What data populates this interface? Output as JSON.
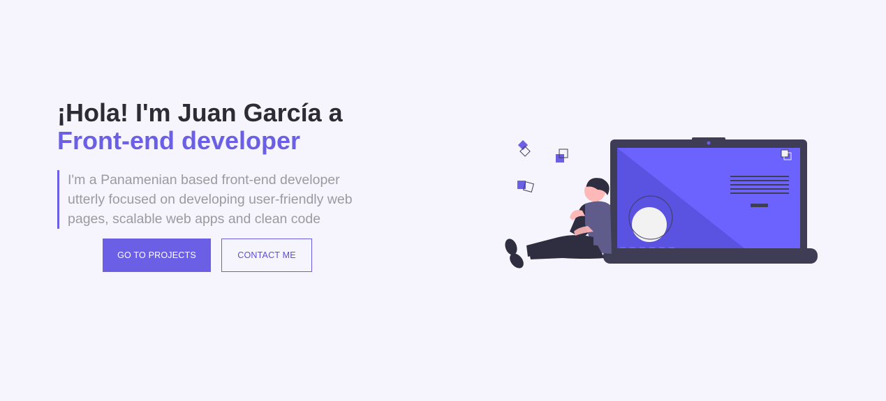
{
  "hero": {
    "headline_line1": "¡Hola! I'm Juan García a",
    "headline_line2": "Front-end developer",
    "intro": "I'm a Panamenian based front-end developer utterly focused on developing user-friendly web pages, scalable web apps and clean code"
  },
  "actions": {
    "projects_label": "GO TO PROJECTS",
    "contact_label": "CONTACT ME"
  },
  "colors": {
    "accent": "#6b5fe6",
    "background": "#f6f5fd",
    "heading": "#2d2b33",
    "body_text": "#9a9a9f",
    "laptop_frame": "#3f3d56"
  },
  "illustration": {
    "name": "developer-with-laptop-illustration"
  }
}
